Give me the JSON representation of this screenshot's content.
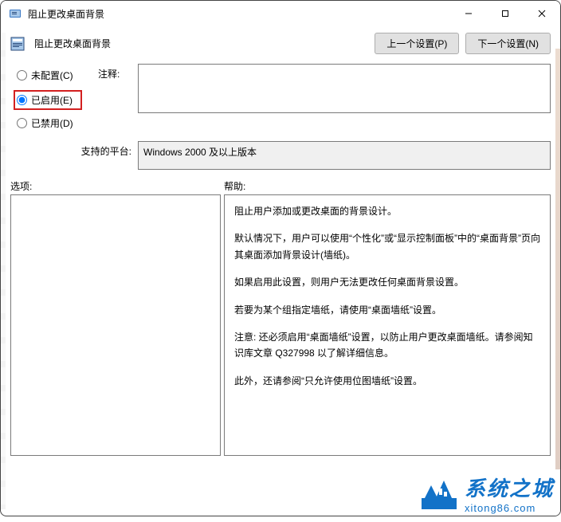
{
  "titlebar": {
    "title": "阻止更改桌面背景"
  },
  "toolbar": {
    "policy_name": "阻止更改桌面背景",
    "prev_label": "上一个设置(P)",
    "next_label": "下一个设置(N)"
  },
  "radios": {
    "not_configured": "未配置(C)",
    "enabled": "已启用(E)",
    "disabled": "已禁用(D)",
    "selected": "enabled"
  },
  "comment": {
    "label": "注释:",
    "value": ""
  },
  "platform": {
    "label": "支持的平台:",
    "value": "Windows 2000 及以上版本"
  },
  "sections": {
    "options_label": "选项:",
    "help_label": "帮助:"
  },
  "help": {
    "p1": "阻止用户添加或更改桌面的背景设计。",
    "p2": "默认情况下，用户可以使用“个性化”或“显示控制面板”中的“桌面背景”页向其桌面添加背景设计(墙纸)。",
    "p3": "如果启用此设置，则用户无法更改任何桌面背景设置。",
    "p4": "若要为某个组指定墙纸，请使用“桌面墙纸”设置。",
    "p5": "注意: 还必须启用“桌面墙纸”设置，以防止用户更改桌面墙纸。请参阅知识库文章 Q327998 以了解详细信息。",
    "p6": "此外，还请参阅“只允许使用位图墙纸”设置。"
  },
  "watermark": {
    "main": "系统之城",
    "sub": "xitong86.com"
  }
}
